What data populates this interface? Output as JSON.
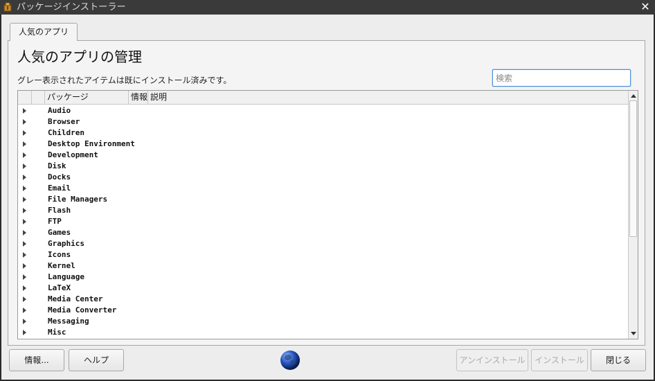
{
  "titlebar": {
    "title": "パッケージインストーラー",
    "close_glyph": "✕",
    "icon": "package-icon"
  },
  "tab": {
    "label": "人気のアプリ"
  },
  "main": {
    "heading": "人気のアプリの管理",
    "subtext": "グレー表示されたアイテムは既にインストール済みです。",
    "search_placeholder": "検索"
  },
  "table": {
    "columns": [
      "",
      "",
      "パッケージ",
      "情報",
      "説明"
    ],
    "rows": [
      "Audio",
      "Browser",
      "Children",
      "Desktop Environment",
      "Development",
      "Disk",
      "Docks",
      "Email",
      "File Managers",
      "Flash",
      "FTP",
      "Games",
      "Graphics",
      "Icons",
      "Kernel",
      "Language",
      "LaTeX",
      "Media Center",
      "Media Converter",
      "Messaging",
      "Misc"
    ]
  },
  "buttons": {
    "about": "情報...",
    "help": "ヘルプ",
    "uninstall": "アンインストール",
    "install": "インストール",
    "close": "閉じる"
  },
  "center_icon": "globe-icon"
}
